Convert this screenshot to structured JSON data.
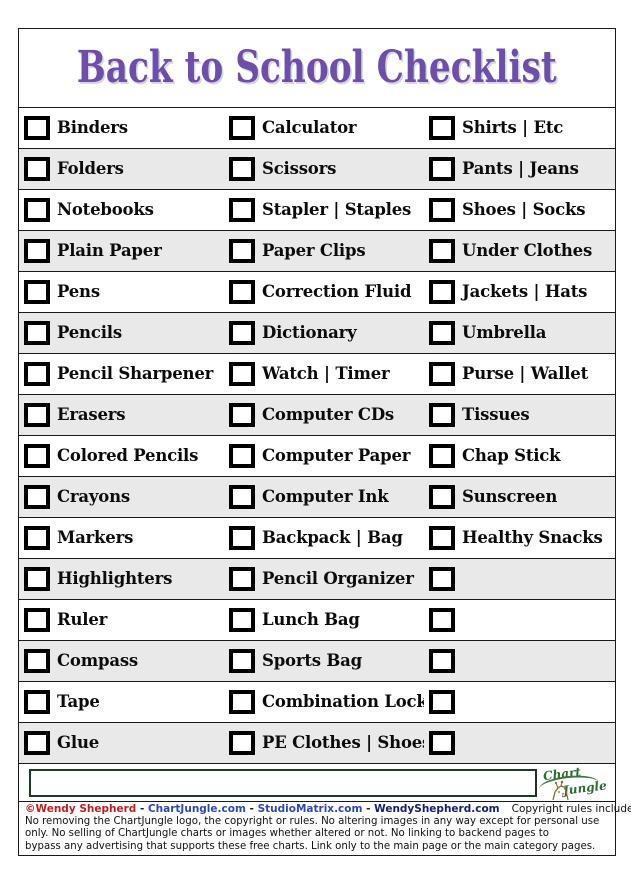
{
  "title": "Back to School Checklist",
  "theme": {
    "title_color": "#6b4fa8",
    "stripe_color": "#e9e9e9",
    "border_color": "#1a1a1a",
    "owner_color": "#c21d1d",
    "link_color": "#2d49b8",
    "logo_color": "#2e6b33"
  },
  "columns": [
    {
      "name": "school-supplies",
      "items": [
        "Binders",
        "Folders",
        "Notebooks",
        "Plain Paper",
        "Pens",
        "Pencils",
        "Pencil Sharpener",
        "Erasers",
        "Colored Pencils",
        "Crayons",
        "Markers",
        "Highlighters",
        "Ruler",
        "Compass",
        "Tape",
        "Glue"
      ]
    },
    {
      "name": "tools-and-tech",
      "items": [
        "Calculator",
        "Scissors",
        "Stapler  |  Staples",
        "Paper Clips",
        "Correction Fluid",
        "Dictionary",
        "Watch  |  Timer",
        "Computer CDs",
        "Computer Paper",
        "Computer Ink",
        "Backpack  |  Bag",
        "Pencil Organizer",
        "Lunch Bag",
        "Sports Bag",
        "Combination Lock",
        "PE Clothes  |  Shoes"
      ]
    },
    {
      "name": "clothing-and-personal",
      "items": [
        "Shirts  |  Etc",
        "Pants  |  Jeans",
        "Shoes  |  Socks",
        "Under Clothes",
        "Jackets  |  Hats",
        "Umbrella",
        "Purse  |  Wallet",
        "Tissues",
        "Chap Stick",
        "Sunscreen",
        "Healthy Snacks",
        "",
        "",
        "",
        "",
        ""
      ]
    }
  ],
  "notes": {
    "placeholder": ""
  },
  "logo": {
    "word_a": "Chart",
    "word_b": "Jungle",
    "critter_name": "giraffe-icon"
  },
  "footer": {
    "copyright_symbol": "©",
    "owner": "Wendy Shepherd",
    "separator": " - ",
    "site1": "ChartJungle.com",
    "site2": "StudioMatrix.com",
    "site3": "WendyShepherd.com",
    "rules_heading": "Copyright rules include:",
    "fineprint": [
      "No removing the ChartJungle logo, the copyright or rules. No altering images in any way except for personal use",
      "only. No selling of ChartJungle charts or images whether altered or not. No linking to backend pages to",
      "bypass any advertising that supports these free charts. Link only to the main page or the main category pages."
    ]
  }
}
